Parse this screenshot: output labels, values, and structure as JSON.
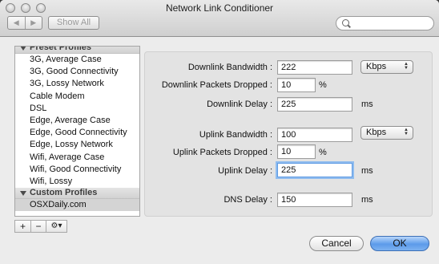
{
  "window": {
    "title": "Network Link Conditioner",
    "show_all_label": "Show All",
    "back_arrow": "◀",
    "forward_arrow": "▶"
  },
  "sidebar": {
    "preset_header": "Preset Profiles",
    "presets": [
      "3G, Average Case",
      "3G, Good Connectivity",
      "3G, Lossy Network",
      "Cable Modem",
      "DSL",
      "Edge, Average Case",
      "Edge, Good Connectivity",
      "Edge, Lossy Network",
      "Wifi, Average Case",
      "Wifi, Good Connectivity",
      "Wifi, Lossy"
    ],
    "custom_header": "Custom Profiles",
    "custom": [
      "OSXDaily.com"
    ],
    "add_label": "+",
    "remove_label": "−",
    "action_label": "⚙▾"
  },
  "form": {
    "downlink_bandwidth": {
      "label": "Downlink Bandwidth :",
      "value": "222",
      "unit": "Kbps"
    },
    "downlink_packets_dropped": {
      "label": "Downlink Packets Dropped :",
      "value": "10",
      "unit": "%"
    },
    "downlink_delay": {
      "label": "Downlink Delay :",
      "value": "225",
      "unit": "ms"
    },
    "uplink_bandwidth": {
      "label": "Uplink Bandwidth :",
      "value": "100",
      "unit": "Kbps"
    },
    "uplink_packets_dropped": {
      "label": "Uplink Packets Dropped :",
      "value": "10",
      "unit": "%"
    },
    "uplink_delay": {
      "label": "Uplink Delay :",
      "value": "225",
      "unit": "ms"
    },
    "dns_delay": {
      "label": "DNS Delay :",
      "value": "150",
      "unit": "ms"
    }
  },
  "buttons": {
    "cancel": "Cancel",
    "ok": "OK"
  },
  "colors": {
    "ok_button": "#5c9bea",
    "focus_ring": "#8fbcef",
    "selected_row": "#d4d4d4"
  }
}
